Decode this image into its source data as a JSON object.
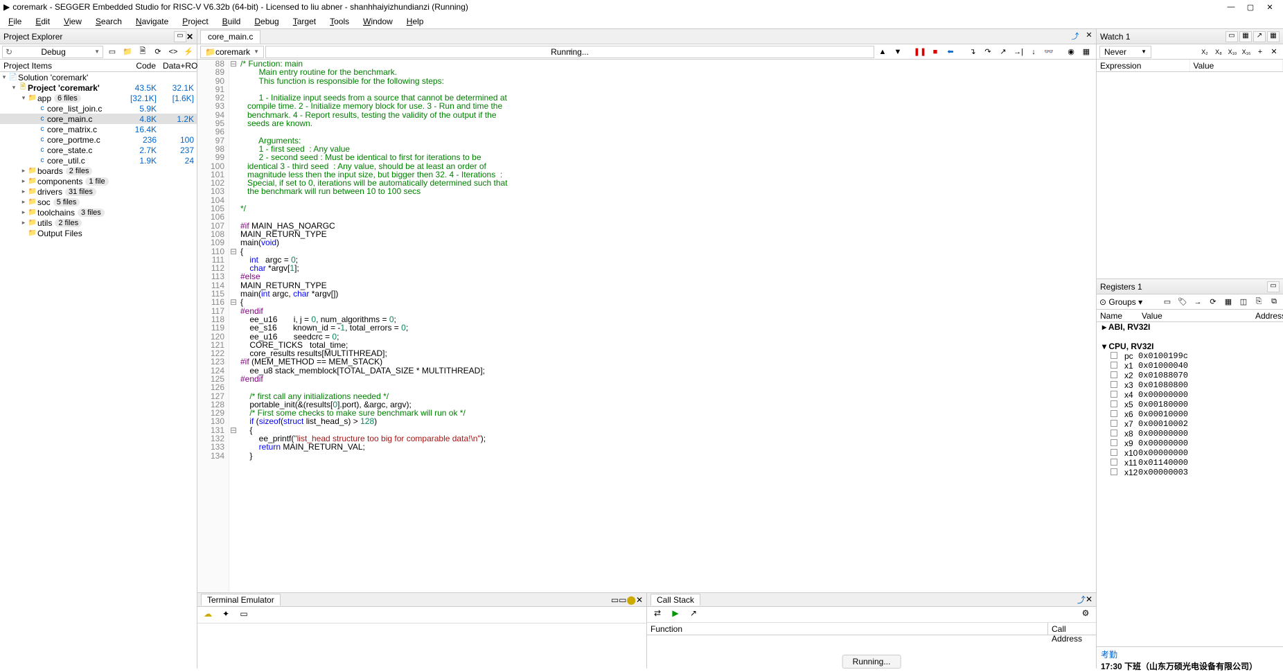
{
  "window": {
    "title": "coremark - SEGGER Embedded Studio for RISC-V V6.32b (64-bit) - Licensed to liu abner - shanhhaiyizhundianzi (Running)"
  },
  "menu": [
    "File",
    "Edit",
    "View",
    "Search",
    "Navigate",
    "Project",
    "Build",
    "Debug",
    "Target",
    "Tools",
    "Window",
    "Help"
  ],
  "projectExplorer": {
    "title": "Project Explorer",
    "config": "Debug",
    "headers": [
      "Project Items",
      "Code",
      "Data+RO"
    ],
    "rows": [
      {
        "indent": 0,
        "exp": "▾",
        "icon": "📄",
        "name": "Solution 'coremark'",
        "code": "",
        "data": ""
      },
      {
        "indent": 1,
        "exp": "▾",
        "icon": "🗎",
        "name": "Project 'coremark'",
        "bold": true,
        "code": "43.5K",
        "data": "32.1K"
      },
      {
        "indent": 2,
        "exp": "▾",
        "icon": "📁",
        "name": "app",
        "badge": "6 files",
        "code": "[32.1K]",
        "data": "[1.6K]"
      },
      {
        "indent": 3,
        "exp": "",
        "icon": "c",
        "name": "core_list_join.c",
        "code": "5.9K",
        "data": ""
      },
      {
        "indent": 3,
        "exp": "",
        "icon": "c",
        "name": "core_main.c",
        "selected": true,
        "code": "4.8K",
        "data": "1.2K"
      },
      {
        "indent": 3,
        "exp": "",
        "icon": "c",
        "name": "core_matrix.c",
        "code": "16.4K",
        "data": ""
      },
      {
        "indent": 3,
        "exp": "",
        "icon": "c",
        "name": "core_portme.c",
        "code": "236",
        "data": "100"
      },
      {
        "indent": 3,
        "exp": "",
        "icon": "c",
        "name": "core_state.c",
        "code": "2.7K",
        "data": "237"
      },
      {
        "indent": 3,
        "exp": "",
        "icon": "c",
        "name": "core_util.c",
        "code": "1.9K",
        "data": "24"
      },
      {
        "indent": 2,
        "exp": "▸",
        "icon": "📁",
        "name": "boards",
        "badge": "2 files",
        "code": "",
        "data": ""
      },
      {
        "indent": 2,
        "exp": "▸",
        "icon": "📁",
        "name": "components",
        "badge": "1 file",
        "code": "",
        "data": ""
      },
      {
        "indent": 2,
        "exp": "▸",
        "icon": "📁",
        "name": "drivers",
        "badge": "31 files",
        "code": "",
        "data": ""
      },
      {
        "indent": 2,
        "exp": "▸",
        "icon": "📁",
        "name": "soc",
        "badge": "5 files",
        "code": "",
        "data": ""
      },
      {
        "indent": 2,
        "exp": "▸",
        "icon": "📁",
        "name": "toolchains",
        "badge": "3 files",
        "code": "",
        "data": ""
      },
      {
        "indent": 2,
        "exp": "▸",
        "icon": "📁",
        "name": "utils",
        "badge": "2 files",
        "code": "",
        "data": ""
      },
      {
        "indent": 2,
        "exp": "",
        "icon": "📁",
        "name": "Output Files",
        "code": "",
        "data": ""
      }
    ]
  },
  "editor": {
    "tab": "core_main.c",
    "functionSelector": "coremark",
    "runningLabel": "Running...",
    "startLine": 88,
    "lines": [
      {
        "cls": "cm-comment",
        "text": "/* Function: main"
      },
      {
        "cls": "cm-comment",
        "text": "        Main entry routine for the benchmark."
      },
      {
        "cls": "cm-comment",
        "text": "        This function is responsible for the following steps:"
      },
      {
        "cls": "",
        "text": ""
      },
      {
        "cls": "cm-comment",
        "text": "        1 - Initialize input seeds from a source that cannot be determined at"
      },
      {
        "cls": "cm-comment",
        "text": "   compile time. 2 - Initialize memory block for use. 3 - Run and time the"
      },
      {
        "cls": "cm-comment",
        "text": "   benchmark. 4 - Report results, testing the validity of the output if the"
      },
      {
        "cls": "cm-comment",
        "text": "   seeds are known."
      },
      {
        "cls": "",
        "text": ""
      },
      {
        "cls": "cm-comment",
        "text": "        Arguments:"
      },
      {
        "cls": "cm-comment",
        "text": "        1 - first seed  : Any value"
      },
      {
        "cls": "cm-comment",
        "text": "        2 - second seed : Must be identical to first for iterations to be"
      },
      {
        "cls": "cm-comment",
        "text": "   identical 3 - third seed  : Any value, should be at least an order of"
      },
      {
        "cls": "cm-comment",
        "text": "   magnitude less then the input size, but bigger then 32. 4 - Iterations  :"
      },
      {
        "cls": "cm-comment",
        "text": "   Special, if set to 0, iterations will be automatically determined such that"
      },
      {
        "cls": "cm-comment",
        "text": "   the benchmark will run between 10 to 100 secs"
      },
      {
        "cls": "",
        "text": ""
      },
      {
        "cls": "cm-comment",
        "text": "*/"
      },
      {
        "cls": "",
        "text": ""
      },
      {
        "html": "<span class='cm-pre'>#if</span> MAIN_HAS_NOARGC"
      },
      {
        "text": "MAIN_RETURN_TYPE"
      },
      {
        "html": "main(<span class='cm-keyword'>void</span>)"
      },
      {
        "text": "{"
      },
      {
        "html": "    <span class='cm-keyword'>int</span>   argc = <span class='cm-num'>0</span>;"
      },
      {
        "html": "    <span class='cm-keyword'>char</span> *argv[<span class='cm-num'>1</span>];"
      },
      {
        "html": "<span class='cm-pre'>#else</span>"
      },
      {
        "text": "MAIN_RETURN_TYPE"
      },
      {
        "html": "main(<span class='cm-keyword'>int</span> argc, <span class='cm-keyword'>char</span> *argv[])"
      },
      {
        "text": "{"
      },
      {
        "html": "<span class='cm-pre'>#endif</span>"
      },
      {
        "html": "    ee_u16       i, j = <span class='cm-num'>0</span>, num_algorithms = <span class='cm-num'>0</span>;"
      },
      {
        "html": "    ee_s16       known_id = -<span class='cm-num'>1</span>, total_errors = <span class='cm-num'>0</span>;"
      },
      {
        "html": "    ee_u16       seedcrc = <span class='cm-num'>0</span>;"
      },
      {
        "text": "    CORE_TICKS   total_time;"
      },
      {
        "text": "    core_results results[MULTITHREAD];"
      },
      {
        "html": "<span class='cm-pre'>#if</span> (MEM_METHOD == MEM_STACK)"
      },
      {
        "text": "    ee_u8 stack_memblock[TOTAL_DATA_SIZE * MULTITHREAD];"
      },
      {
        "html": "<span class='cm-pre'>#endif</span>"
      },
      {
        "text": ""
      },
      {
        "html": "    <span class='cm-comment'>/* first call any initializations needed */</span>"
      },
      {
        "html": "    portable_init(&amp;(results[<span class='cm-num'>0</span>].port), &amp;argc, argv);"
      },
      {
        "html": "    <span class='cm-comment'>/* First some checks to make sure benchmark will run ok */</span>"
      },
      {
        "html": "    <span class='cm-keyword'>if</span> (<span class='cm-keyword'>sizeof</span>(<span class='cm-keyword'>struct</span> list_head_s) &gt; <span class='cm-num'>128</span>)"
      },
      {
        "text": "    {"
      },
      {
        "html": "        ee_printf(<span class='cm-string'>\"list_head structure too big for comparable data!\\n\"</span>);"
      },
      {
        "html": "        <span class='cm-keyword'>return</span> MAIN_RETURN_VAL;"
      },
      {
        "text": "    }"
      }
    ]
  },
  "terminal": {
    "title": "Terminal Emulator"
  },
  "callstack": {
    "title": "Call Stack",
    "headers": [
      "Function",
      "Call Address"
    ],
    "running": "Running..."
  },
  "watch": {
    "title": "Watch 1",
    "mode": "Never",
    "headers": [
      "Expression",
      "Value"
    ]
  },
  "registers": {
    "title": "Registers 1",
    "groupsLabel": "Groups",
    "headers": [
      "Name",
      "Value",
      "Address"
    ],
    "groups": [
      {
        "name": "ABI, RV32I"
      },
      {
        "name": "CPU, RV32I",
        "expanded": true
      }
    ],
    "regs": [
      {
        "n": "pc",
        "v": "0x0100199c"
      },
      {
        "n": "x1",
        "v": "0x01000040"
      },
      {
        "n": "x2",
        "v": "0x01088070"
      },
      {
        "n": "x3",
        "v": "0x01080800"
      },
      {
        "n": "x4",
        "v": "0x00000000"
      },
      {
        "n": "x5",
        "v": "0x00180000"
      },
      {
        "n": "x6",
        "v": "0x00010000"
      },
      {
        "n": "x7",
        "v": "0x00010002"
      },
      {
        "n": "x8",
        "v": "0x00000000"
      },
      {
        "n": "x9",
        "v": "0x00000000"
      },
      {
        "n": "x10",
        "v": "0x00000000"
      },
      {
        "n": "x11",
        "v": "0x01140000"
      },
      {
        "n": "x12",
        "v": "0x00000003"
      }
    ]
  },
  "statusExtra": {
    "line1": "考勤",
    "line2": "17:30 下班（山东万硕光电设备有限公司）"
  }
}
